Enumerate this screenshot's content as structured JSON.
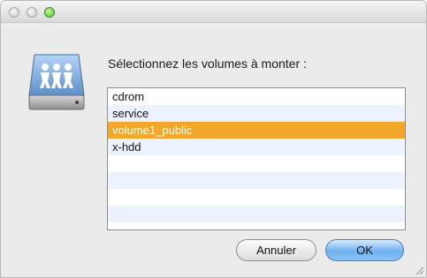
{
  "dialog": {
    "prompt": "Sélectionnez les volumes à monter :",
    "volumes": [
      "cdrom",
      "service",
      "volume1_public",
      "x-hdd",
      "",
      "",
      "",
      ""
    ],
    "selected_volume": "volume1_public",
    "cancel_label": "Annuler",
    "ok_label": "OK"
  },
  "colors": {
    "selection": "#f2a72a",
    "ok_button": "#6fb0ee",
    "zoom_light": "#53b72e"
  },
  "icons": {
    "window_controls": [
      "close-icon",
      "minimize-icon",
      "zoom-icon"
    ],
    "volume": "network-drive-icon",
    "resize": "resize-grip-icon"
  }
}
